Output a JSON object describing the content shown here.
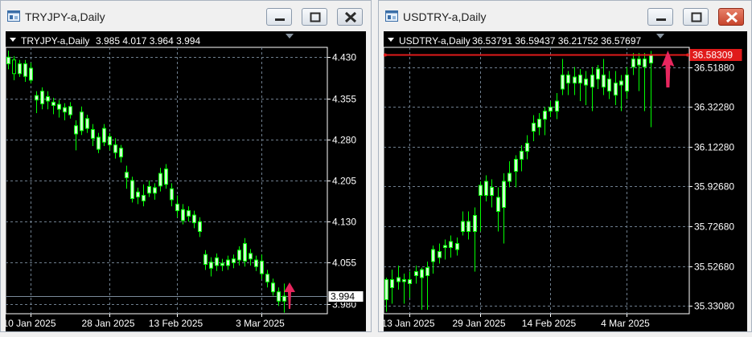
{
  "colors": {
    "background": "#000000",
    "grid": "#6f7f8f",
    "bull": "#ccffcc",
    "wick": "#00ff00",
    "axis_text": "#ffffff",
    "arrow": "#e8265e",
    "hline_left": "#7b8b9b",
    "hline_right": "#e01a1a",
    "label_right_bg": "#e01a1a"
  },
  "windows": [
    {
      "title": "TRYJPY-a,Daily",
      "header": {
        "symbol": "TRYJPY-a,Daily",
        "ohlc": "3.985 4.017 3.964 3.994"
      },
      "buttons": {
        "minimize": "minimize-icon",
        "maximize": "maximize-icon",
        "close": "close-icon"
      },
      "current_price_label": "3.994",
      "chart_data": {
        "type": "candlestick",
        "ylim": [
          3.962,
          4.448
        ],
        "yticks": [
          "4.430",
          "4.355",
          "4.280",
          "4.205",
          "4.130",
          "4.055",
          "3.980"
        ],
        "ytick_values": [
          4.43,
          4.355,
          4.28,
          4.205,
          4.13,
          4.055,
          3.98
        ],
        "xticks": [
          "10 Jan 2025",
          "28 Jan 2025",
          "13 Feb 2025",
          "3 Mar 2025"
        ],
        "xtick_index": [
          4,
          18,
          30,
          45
        ],
        "current_price": 3.994,
        "arrow_index": 50,
        "candles": [
          [
            4.418,
            4.442,
            4.408,
            4.43
          ],
          [
            4.425,
            4.432,
            4.388,
            4.4
          ],
          [
            4.4,
            4.425,
            4.394,
            4.418
          ],
          [
            4.395,
            4.425,
            4.385,
            4.418
          ],
          [
            4.388,
            4.42,
            4.382,
            4.41
          ],
          [
            4.352,
            4.368,
            4.328,
            4.36
          ],
          [
            4.345,
            4.375,
            4.335,
            4.368
          ],
          [
            4.35,
            4.368,
            4.335,
            4.358
          ],
          [
            4.342,
            4.356,
            4.326,
            4.348
          ],
          [
            4.335,
            4.352,
            4.32,
            4.344
          ],
          [
            4.33,
            4.346,
            4.315,
            4.338
          ],
          [
            4.325,
            4.348,
            4.318,
            4.34
          ],
          [
            4.29,
            4.315,
            4.26,
            4.305
          ],
          [
            4.296,
            4.34,
            4.288,
            4.33
          ],
          [
            4.3,
            4.325,
            4.292,
            4.318
          ],
          [
            4.282,
            4.308,
            4.268,
            4.298
          ],
          [
            4.262,
            4.292,
            4.255,
            4.284
          ],
          [
            4.275,
            4.308,
            4.268,
            4.3
          ],
          [
            4.27,
            4.292,
            4.26,
            4.285
          ],
          [
            4.256,
            4.282,
            4.245,
            4.27
          ],
          [
            4.248,
            4.27,
            4.238,
            4.264
          ],
          [
            4.21,
            4.232,
            4.19,
            4.22
          ],
          [
            4.172,
            4.212,
            4.165,
            4.205
          ],
          [
            4.175,
            4.192,
            4.162,
            4.184
          ],
          [
            4.168,
            4.198,
            4.158,
            4.178
          ],
          [
            4.182,
            4.205,
            4.175,
            4.194
          ],
          [
            4.182,
            4.2,
            4.17,
            4.192
          ],
          [
            4.195,
            4.228,
            4.185,
            4.218
          ],
          [
            4.198,
            4.235,
            4.19,
            4.226
          ],
          [
            4.17,
            4.2,
            4.158,
            4.19
          ],
          [
            4.15,
            4.178,
            4.138,
            4.162
          ],
          [
            4.132,
            4.162,
            4.125,
            4.152
          ],
          [
            4.14,
            4.158,
            4.13,
            4.15
          ],
          [
            4.128,
            4.15,
            4.118,
            4.142
          ],
          [
            4.112,
            4.138,
            4.102,
            4.13
          ],
          [
            4.052,
            4.078,
            4.042,
            4.07
          ],
          [
            4.045,
            4.065,
            4.03,
            4.056
          ],
          [
            4.05,
            4.072,
            4.04,
            4.064
          ],
          [
            4.05,
            4.062,
            4.04,
            4.054
          ],
          [
            4.05,
            4.068,
            4.042,
            4.06
          ],
          [
            4.055,
            4.07,
            4.045,
            4.062
          ],
          [
            4.06,
            4.085,
            4.05,
            4.078
          ],
          [
            4.058,
            4.1,
            4.048,
            4.09
          ],
          [
            4.062,
            4.08,
            4.05,
            4.072
          ],
          [
            4.048,
            4.068,
            4.04,
            4.06
          ],
          [
            4.035,
            4.07,
            4.025,
            4.058
          ],
          [
            4.02,
            4.042,
            4.01,
            4.034
          ],
          [
            4.002,
            4.026,
            3.995,
            4.018
          ],
          [
            3.985,
            4.01,
            3.976,
            4.002
          ],
          [
            3.985,
            4.017,
            3.964,
            3.994
          ]
        ]
      }
    },
    {
      "title": "USDTRY-a,Daily",
      "header": {
        "symbol": "USDTRY-a,Daily",
        "ohlc": "36.53791 36.59437 36.21752 36.57697"
      },
      "buttons": {
        "minimize": "minimize-icon",
        "maximize": "maximize-icon",
        "close": "close-icon"
      },
      "current_price_label": "36.58309",
      "chart_data": {
        "type": "candlestick",
        "ylim": [
          35.29,
          36.618
        ],
        "yticks": [
          "36.51880",
          "36.32280",
          "36.12280",
          "35.92680",
          "35.72680",
          "35.52680",
          "35.33080"
        ],
        "ytick_values": [
          36.5188,
          36.3228,
          36.1228,
          35.9268,
          35.7268,
          35.5268,
          35.3308
        ],
        "xticks": [
          "13 Jan 2025",
          "29 Jan 2025",
          "14 Feb 2025",
          "4 Mar 2025"
        ],
        "xtick_index": [
          4,
          16,
          28,
          41
        ],
        "current_price": 36.58309,
        "arrow_index": 48,
        "candles": [
          [
            35.36,
            35.47,
            35.3,
            35.46
          ],
          [
            35.42,
            35.51,
            35.34,
            35.46
          ],
          [
            35.45,
            35.53,
            35.41,
            35.47
          ],
          [
            35.45,
            35.49,
            35.34,
            35.46
          ],
          [
            35.44,
            35.5,
            35.37,
            35.46
          ],
          [
            35.48,
            35.53,
            35.44,
            35.5
          ],
          [
            35.47,
            35.52,
            35.31,
            35.51
          ],
          [
            35.48,
            35.55,
            35.31,
            35.52
          ],
          [
            35.55,
            35.63,
            35.49,
            35.61
          ],
          [
            35.57,
            35.64,
            35.54,
            35.6
          ],
          [
            35.62,
            35.66,
            35.56,
            35.63
          ],
          [
            35.62,
            35.68,
            35.57,
            35.65
          ],
          [
            35.61,
            35.67,
            35.58,
            35.64
          ],
          [
            35.7,
            35.8,
            35.68,
            35.75
          ],
          [
            35.7,
            35.8,
            35.66,
            35.75
          ],
          [
            35.7,
            35.82,
            35.5,
            35.78
          ],
          [
            35.88,
            35.95,
            35.7,
            35.93
          ],
          [
            35.88,
            35.98,
            35.85,
            35.95
          ],
          [
            35.88,
            35.96,
            35.82,
            35.92
          ],
          [
            35.8,
            35.92,
            35.7,
            35.87
          ],
          [
            35.82,
            35.99,
            35.64,
            35.95
          ],
          [
            35.95,
            36.05,
            35.92,
            35.99
          ],
          [
            36.0,
            36.08,
            35.92,
            36.06
          ],
          [
            36.06,
            36.13,
            36.0,
            36.1
          ],
          [
            36.1,
            36.18,
            36.06,
            36.14
          ],
          [
            36.2,
            36.28,
            36.15,
            36.24
          ],
          [
            36.22,
            36.29,
            36.18,
            36.26
          ],
          [
            36.26,
            36.32,
            36.18,
            36.3
          ],
          [
            36.3,
            36.35,
            36.27,
            36.32
          ],
          [
            36.3,
            36.39,
            36.26,
            36.35
          ],
          [
            36.41,
            36.56,
            36.38,
            36.48
          ],
          [
            36.44,
            36.5,
            36.38,
            36.48
          ],
          [
            36.44,
            36.52,
            36.38,
            36.47
          ],
          [
            36.44,
            36.51,
            36.35,
            36.48
          ],
          [
            36.43,
            36.5,
            36.33,
            36.46
          ],
          [
            36.42,
            36.52,
            36.3,
            36.48
          ],
          [
            36.46,
            36.53,
            36.41,
            36.51
          ],
          [
            36.42,
            36.56,
            36.38,
            36.48
          ],
          [
            36.4,
            36.5,
            36.36,
            36.46
          ],
          [
            36.38,
            36.5,
            36.33,
            36.44
          ],
          [
            36.43,
            36.48,
            36.3,
            36.45
          ],
          [
            36.4,
            36.52,
            36.36,
            36.48
          ],
          [
            36.52,
            36.59,
            36.48,
            36.56
          ],
          [
            36.53,
            36.59,
            36.4,
            36.56
          ],
          [
            36.52,
            36.59,
            36.3,
            36.56
          ],
          [
            36.54,
            36.6,
            36.22,
            36.58
          ]
        ]
      }
    }
  ]
}
